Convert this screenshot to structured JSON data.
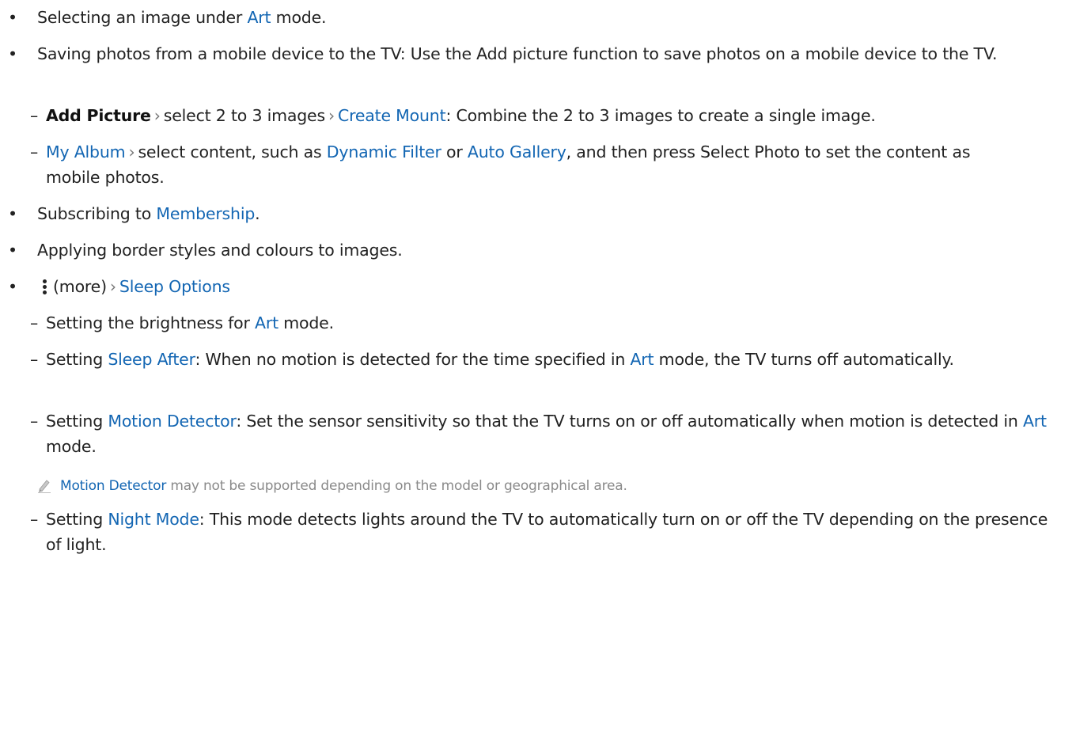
{
  "items": [
    {
      "id": "i1",
      "level": 1,
      "parts": [
        {
          "t": "Selecting an image under "
        },
        {
          "t": "Art",
          "link": true
        },
        {
          "t": " mode."
        }
      ]
    },
    {
      "id": "i2",
      "level": 1,
      "parts": [
        {
          "t": "Saving photos from a mobile device to the TV: Use the Add picture function to save photos on a mobile device to the TV."
        }
      ]
    },
    {
      "id": "i3",
      "level": 2,
      "parts": [
        {
          "t": "Add Picture",
          "bold": true
        },
        {
          "chev": true
        },
        {
          "t": "select 2 to 3 images"
        },
        {
          "chev": true
        },
        {
          "t": "Create Mount",
          "link": true
        },
        {
          "t": ": Combine the 2 to 3 images to create a single image."
        }
      ]
    },
    {
      "id": "i4",
      "level": 2,
      "parts": [
        {
          "t": "My Album",
          "link": true
        },
        {
          "chev": true
        },
        {
          "t": "select content, such as "
        },
        {
          "t": "Dynamic Filter",
          "link": true
        },
        {
          "t": " or "
        },
        {
          "t": "Auto Gallery",
          "link": true
        },
        {
          "t": ", and then press Select Photo to set the content as mobile photos."
        }
      ]
    },
    {
      "id": "i5",
      "level": 1,
      "parts": [
        {
          "t": "Subscribing to "
        },
        {
          "t": "Membership",
          "link": true
        },
        {
          "t": "."
        }
      ]
    },
    {
      "id": "i6",
      "level": 1,
      "parts": [
        {
          "t": "Applying border styles and colours to images."
        }
      ]
    },
    {
      "id": "i7",
      "level": 1,
      "parts": [
        {
          "more": true
        },
        {
          "t": "(more)"
        },
        {
          "chev": true
        },
        {
          "t": "Sleep Options",
          "link": true
        }
      ]
    },
    {
      "id": "i8",
      "level": 2,
      "parts": [
        {
          "t": "Setting the brightness for "
        },
        {
          "t": "Art",
          "link": true
        },
        {
          "t": " mode."
        }
      ]
    },
    {
      "id": "i9",
      "level": 2,
      "parts": [
        {
          "t": "Setting "
        },
        {
          "t": "Sleep After",
          "link": true
        },
        {
          "t": ": When no motion is detected for the time specified in "
        },
        {
          "t": "Art",
          "link": true
        },
        {
          "t": " mode, the TV turns off automatically."
        }
      ]
    },
    {
      "id": "i10",
      "level": 2,
      "parts": [
        {
          "t": "Setting "
        },
        {
          "t": "Motion Detector",
          "link": true
        },
        {
          "t": ": Set the sensor sensitivity so that the TV turns on or off automatically when motion is detected in "
        },
        {
          "t": "Art",
          "link": true
        },
        {
          "t": " mode."
        }
      ]
    },
    {
      "id": "i11",
      "level": "note",
      "parts": [
        {
          "t": "Motion Detector",
          "link": true
        },
        {
          "t": " may not be supported depending on the model or geographical area."
        }
      ]
    },
    {
      "id": "i12",
      "level": 2,
      "parts": [
        {
          "t": "Setting "
        },
        {
          "t": "Night Mode",
          "link": true
        },
        {
          "t": ": This mode detects lights around the TV to automatically turn on or off the TV depending on the presence of light."
        }
      ]
    }
  ],
  "markers": {
    "bullet": "•",
    "dash": "–",
    "chevron": "›"
  },
  "colors": {
    "link": "#1366b3",
    "text": "#222222",
    "note": "#8a8a8a"
  }
}
